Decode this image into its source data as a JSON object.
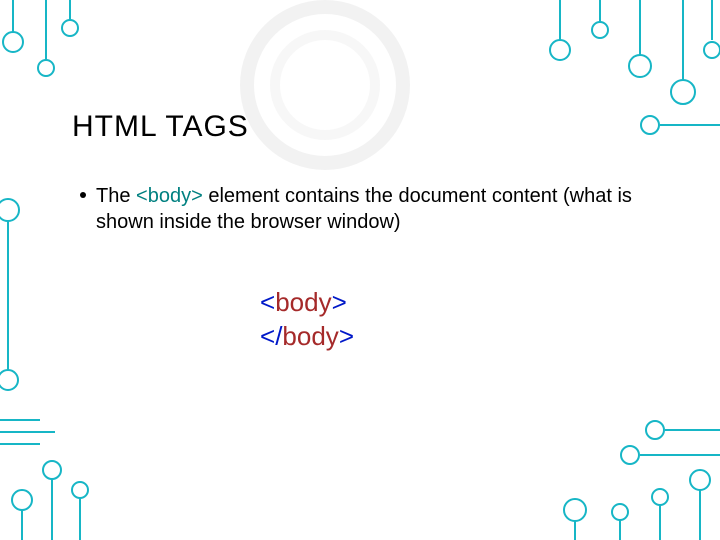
{
  "title": "HTML TAGS",
  "bullet": {
    "pre": "The ",
    "tag": "<body>",
    "post": " element contains the document content (what is shown inside the browser window)"
  },
  "code": {
    "open_lt": "<",
    "open_name": "body",
    "open_gt": ">",
    "close_lt": "<",
    "close_slash": "/",
    "close_name": "body",
    "close_gt": ">"
  }
}
